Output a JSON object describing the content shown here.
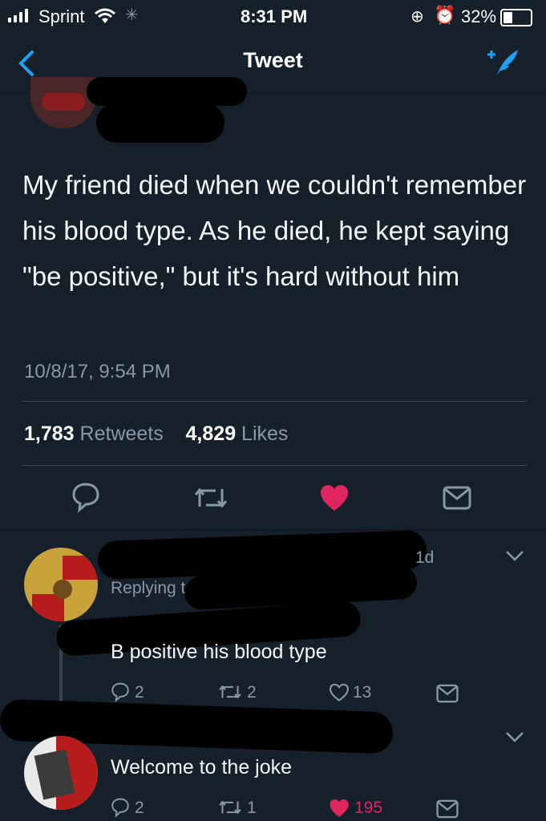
{
  "status_bar": {
    "carrier": "Sprint",
    "time": "8:31 PM",
    "battery": "32%"
  },
  "nav": {
    "title": "Tweet"
  },
  "tweet": {
    "text": "My friend died when we couldn't remember his blood type. As he died, he kept saying \"be positive,\" but it's hard without him",
    "timestamp": "10/8/17, 9:54 PM",
    "retweets_count": "1,783",
    "retweets_label": "Retweets",
    "likes_count": "4,829",
    "likes_label": "Likes",
    "liked": true
  },
  "replies": [
    {
      "age": "1d",
      "replying_prefix": "Replying t",
      "text": "B positive his blood type",
      "reply_count": "2",
      "retweet_count": "2",
      "like_count": "13",
      "liked": false
    },
    {
      "text": "Welcome to the joke",
      "reply_count": "2",
      "retweet_count": "1",
      "like_count": "195",
      "liked": true
    }
  ],
  "colors": {
    "background": "#15202b",
    "accent": "#1da1f2",
    "like": "#e0245e",
    "muted": "#8899a6"
  }
}
